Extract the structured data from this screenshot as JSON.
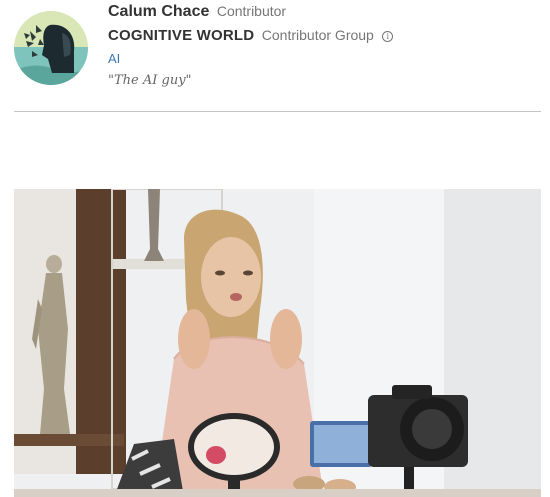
{
  "author": {
    "name": "Calum Chace",
    "role": "Contributor",
    "group_name": "COGNITIVE WORLD",
    "group_role": "Contributor Group",
    "topic": "AI",
    "tagline": "\"The AI guy\"",
    "avatar_icon": "author-avatar",
    "info_icon": "info-icon"
  },
  "colors": {
    "name_text": "#333333",
    "muted_text": "#767676",
    "link": "#3b78b3",
    "divider": "#c4c4c4"
  },
  "hero": {
    "icon": "hero-photo"
  }
}
